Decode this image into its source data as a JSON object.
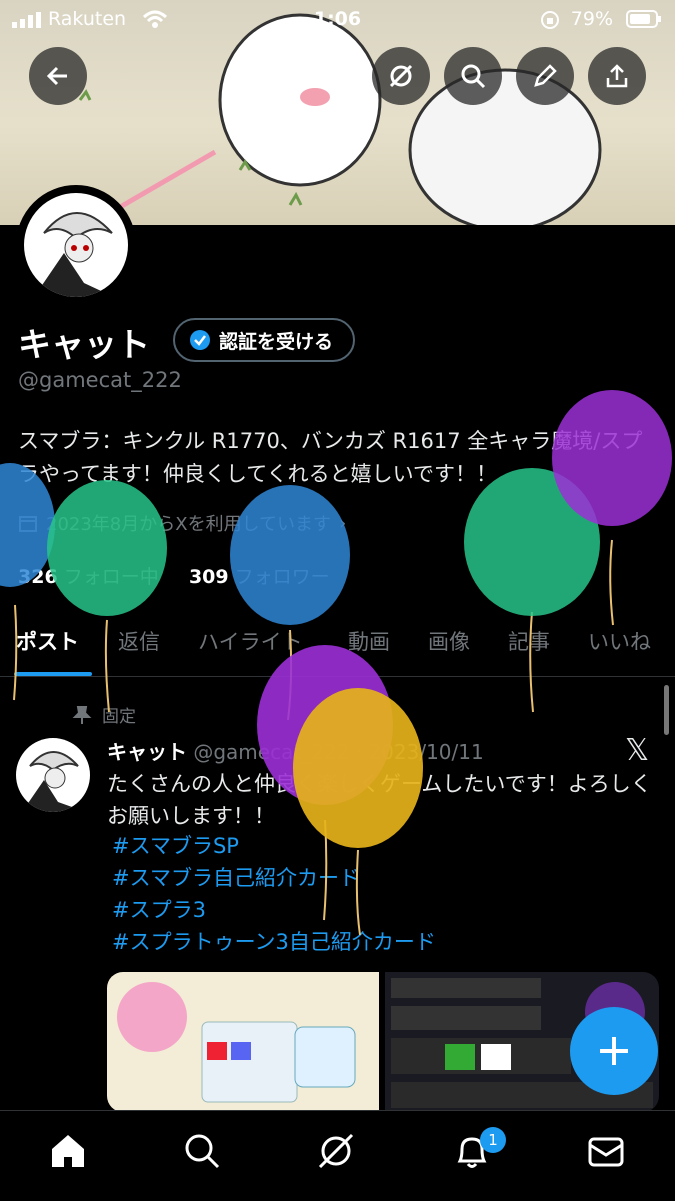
{
  "status": {
    "carrier": "Rakuten",
    "time": "1:06",
    "battery": "79%"
  },
  "profile": {
    "name": "キャット",
    "verify_label": "認証を受ける",
    "handle": "@gamecat_222",
    "bio": "スマブラ：キンクル R1770、バンカズ R1617 全キャラ魔境/スプラやってます！仲良くしてくれると嬉しいです！！",
    "joined": "2023年8月からXを利用しています",
    "following_count": "326",
    "following_label": "フォロー中",
    "followers_count": "309",
    "followers_label": "フォロワー"
  },
  "tabs": [
    "ポスト",
    "返信",
    "ハイライト",
    "動画",
    "画像",
    "記事",
    "いいね"
  ],
  "post": {
    "pinned_label": "固定",
    "author": "キャット",
    "handle_date": "@gamecat_222 · 2023/10/11",
    "text": "たくさんの人と仲良く楽しくゲームしたいです！よろしくお願いします！！",
    "hashtags": [
      "#スマブラSP",
      "#スマブラ自己紹介カード",
      "#スプラ3",
      "#スプラトゥーン3自己紹介カード"
    ]
  },
  "notifications_badge": "1",
  "colors": {
    "accent": "#1d9bf0",
    "background": "#000000"
  },
  "balloon_colors": [
    "#2f86d6",
    "#27c48a",
    "#2f86d6",
    "#27c48a",
    "#9b2fd6",
    "#9b2fd6",
    "#e6b21a"
  ]
}
